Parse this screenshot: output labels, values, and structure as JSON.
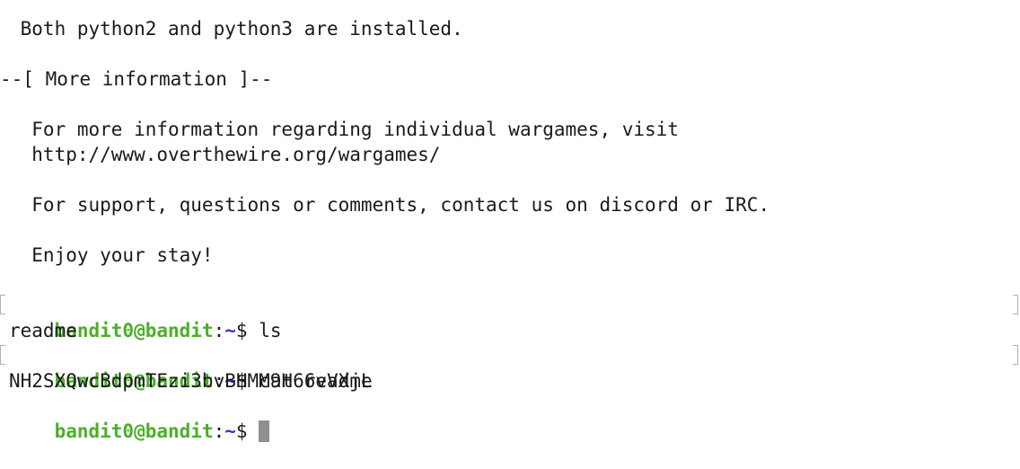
{
  "motd": {
    "python_line": " Both python2 and python3 are installed.",
    "more_info_header": "--[ More information ]--",
    "info_line1": "  For more information regarding individual wargames, visit",
    "info_line2": "  http://www.overthewire.org/wargames/",
    "support_line": "  For support, questions or comments, contact us on discord or IRC.",
    "enjoy_line": "  Enjoy your stay!"
  },
  "prompt": {
    "user_host": "bandit0@bandit",
    "colon": ":",
    "path": "~",
    "symbol": "$ "
  },
  "history": [
    {
      "command": "ls",
      "output": "readme"
    },
    {
      "command": "cat readme",
      "output": "NH2SXQwcBdpmTEzi3bvBHMM9H66vVXjL"
    }
  ],
  "colors": {
    "user_host": "#4caf2a",
    "path": "#2f36d8",
    "cursor": "#8f8f8f"
  }
}
